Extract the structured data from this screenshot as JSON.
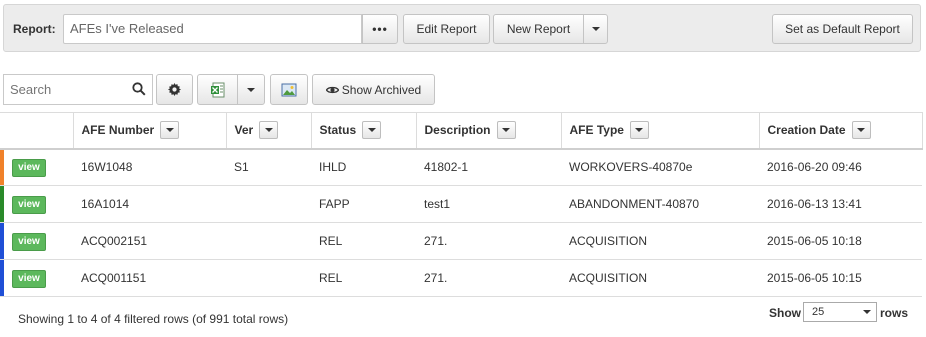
{
  "report_bar": {
    "label": "Report:",
    "current_report": "AFEs I've Released",
    "dots_label": "•••",
    "edit_label": "Edit Report",
    "new_label": "New Report",
    "default_label": "Set as Default Report"
  },
  "toolbar": {
    "search_placeholder": "Search",
    "show_archived_label": "Show Archived"
  },
  "table": {
    "columns": [
      "",
      "AFE Number",
      "Ver",
      "Status",
      "Description",
      "AFE Type",
      "Creation Date"
    ],
    "view_label": "view",
    "rows": [
      {
        "marker_color": "#f0812a",
        "afe_number": "16W1048",
        "ver": "S1",
        "status": "IHLD",
        "description": "41802-1",
        "afe_type": "WORKOVERS-40870e",
        "creation_date": "2016-06-20 09:46"
      },
      {
        "marker_color": "#2a8a2a",
        "afe_number": "16A1014",
        "ver": "",
        "status": "FAPP",
        "description": "test1",
        "afe_type": "ABANDONMENT-40870",
        "creation_date": "2016-06-13 13:41"
      },
      {
        "marker_color": "#1f4fd6",
        "afe_number": "ACQ002151",
        "ver": "",
        "status": "REL",
        "description": "271.",
        "afe_type": "ACQUISITION",
        "creation_date": "2015-06-05 10:18"
      },
      {
        "marker_color": "#1f4fd6",
        "afe_number": "ACQ001151",
        "ver": "",
        "status": "REL",
        "description": "271.",
        "afe_type": "ACQUISITION",
        "creation_date": "2015-06-05 10:15"
      }
    ]
  },
  "footer": {
    "info": "Showing 1 to 4 of 4 filtered rows (of 991 total rows)",
    "show_label": "Show",
    "rows_value": "25",
    "rows_label": "rows"
  },
  "colors": {
    "view_button": "#5cb85c"
  }
}
